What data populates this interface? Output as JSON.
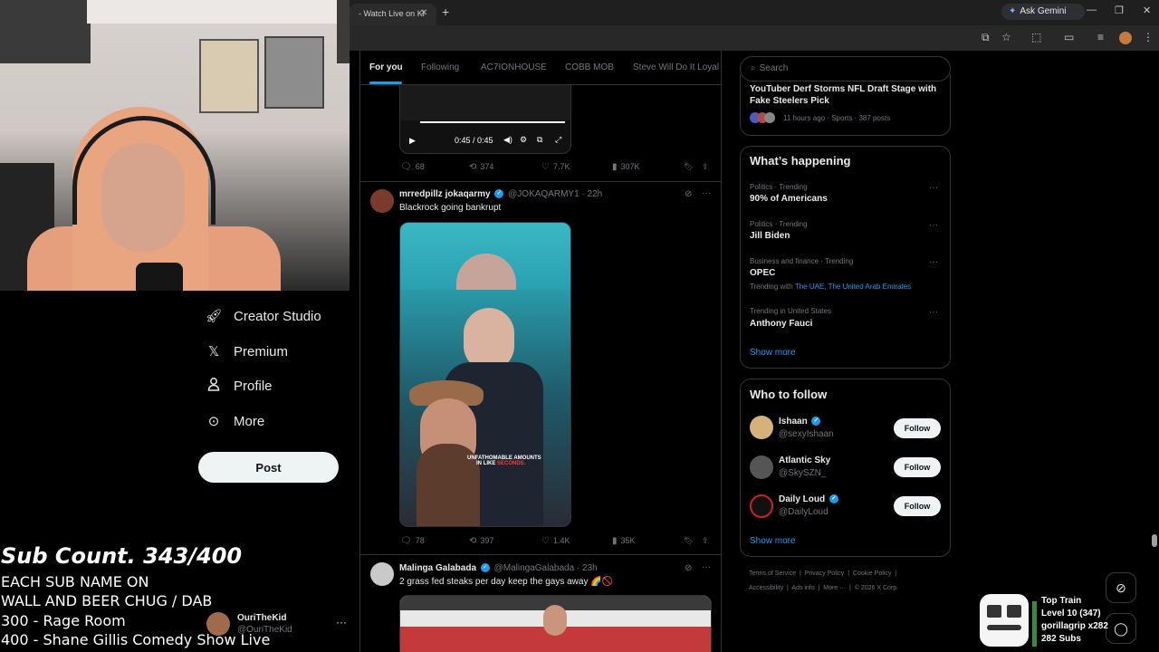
{
  "browser": {
    "tab_title": "- Watch Live on Ki",
    "tab_close": "✕",
    "new_tab": "+",
    "ask_gemini": "Ask Gemini"
  },
  "nav": {
    "items": [
      {
        "label": "Creator Studio",
        "icon": "rocket-icon"
      },
      {
        "label": "Premium",
        "icon": "x-logo-icon"
      },
      {
        "label": "Profile",
        "icon": "person-icon"
      },
      {
        "label": "More",
        "icon": "more-circle-icon"
      }
    ],
    "post_label": "Post",
    "account": {
      "name": "OuriTheKid",
      "handle": "@OuriTheKid",
      "more": "···"
    }
  },
  "overlay": {
    "title": "Sub Count. 343/400",
    "lines": [
      "EACH SUB NAME ON",
      "WALL AND BEER CHUG / DAB",
      "300 - Rage Room",
      "400 - Shane Gillis Comedy Show Live"
    ]
  },
  "feed": {
    "tabs": [
      "For you",
      "Following",
      "AC7IONHOUSE",
      "COBB MOB",
      "Steve Will Do It Loyal"
    ],
    "video": {
      "time": "0:45 / 0:45"
    },
    "tweet0_stats": {
      "replies": "68",
      "reposts": "374",
      "likes": "7.7K",
      "views": "307K"
    },
    "tweets": [
      {
        "name": "mrredpillz jokaqarmy",
        "handle": "@JOKAQARMY1",
        "time": "· 22h",
        "text": "Blackrock going bankrupt",
        "caption_line1": "UNFATHOMABLE AMOUNTS",
        "caption_line2_a": "IN LIKE ",
        "caption_line2_b": "SECONDS.",
        "stats": {
          "replies": "78",
          "reposts": "397",
          "likes": "1.4K",
          "views": "35K"
        }
      },
      {
        "name": "Malinga Galabada",
        "handle": "@MalingaGalabada",
        "time": "· 23h",
        "text": "2 grass fed steaks per day keep the gays away 🌈🚫"
      }
    ]
  },
  "right": {
    "search_placeholder": "Search",
    "top_story": {
      "title_line1": "YouTuber Derf Storms NFL Draft Stage with",
      "title_line2": "Fake Steelers Pick",
      "meta": "11 hours ago · Sports · 387 posts"
    },
    "whats_happening": {
      "title": "What’s happening",
      "trends": [
        {
          "meta": "Politics · Trending",
          "name": "90% of Americans"
        },
        {
          "meta": "Politics · Trending",
          "name": "Jill Biden"
        },
        {
          "meta": "Business and finance · Trending",
          "name": "OPEC",
          "extra_prefix": "Trending with ",
          "extra_links": "The UAE, The United Arab Emirates"
        },
        {
          "meta": "Trending in United States",
          "name": "Anthony Fauci"
        }
      ],
      "show_more": "Show more"
    },
    "who_to_follow": {
      "title": "Who to follow",
      "accounts": [
        {
          "name": "Ishaan",
          "handle": "@sexyIshaan",
          "verified": true
        },
        {
          "name": "Atlantic Sky",
          "handle": "@SkySZN_",
          "verified": false
        },
        {
          "name": "Daily Loud",
          "handle": "@DailyLoud",
          "verified": true
        }
      ],
      "follow_label": "Follow",
      "show_more": "Show more"
    },
    "footer": {
      "line1": [
        "Terms of Service",
        "Privacy Policy",
        "Cookie Policy"
      ],
      "line2": [
        "Accessibility",
        "Ads info",
        "More ···",
        "© 2026 X Corp."
      ]
    }
  },
  "train": {
    "title": "Top Train",
    "level": "Level 10  (347)",
    "user": "gorillagrip x282",
    "subs": "282 Subs"
  },
  "colors": {
    "accent": "#1d9bf0",
    "background": "#000000",
    "muted": "#71767b"
  }
}
